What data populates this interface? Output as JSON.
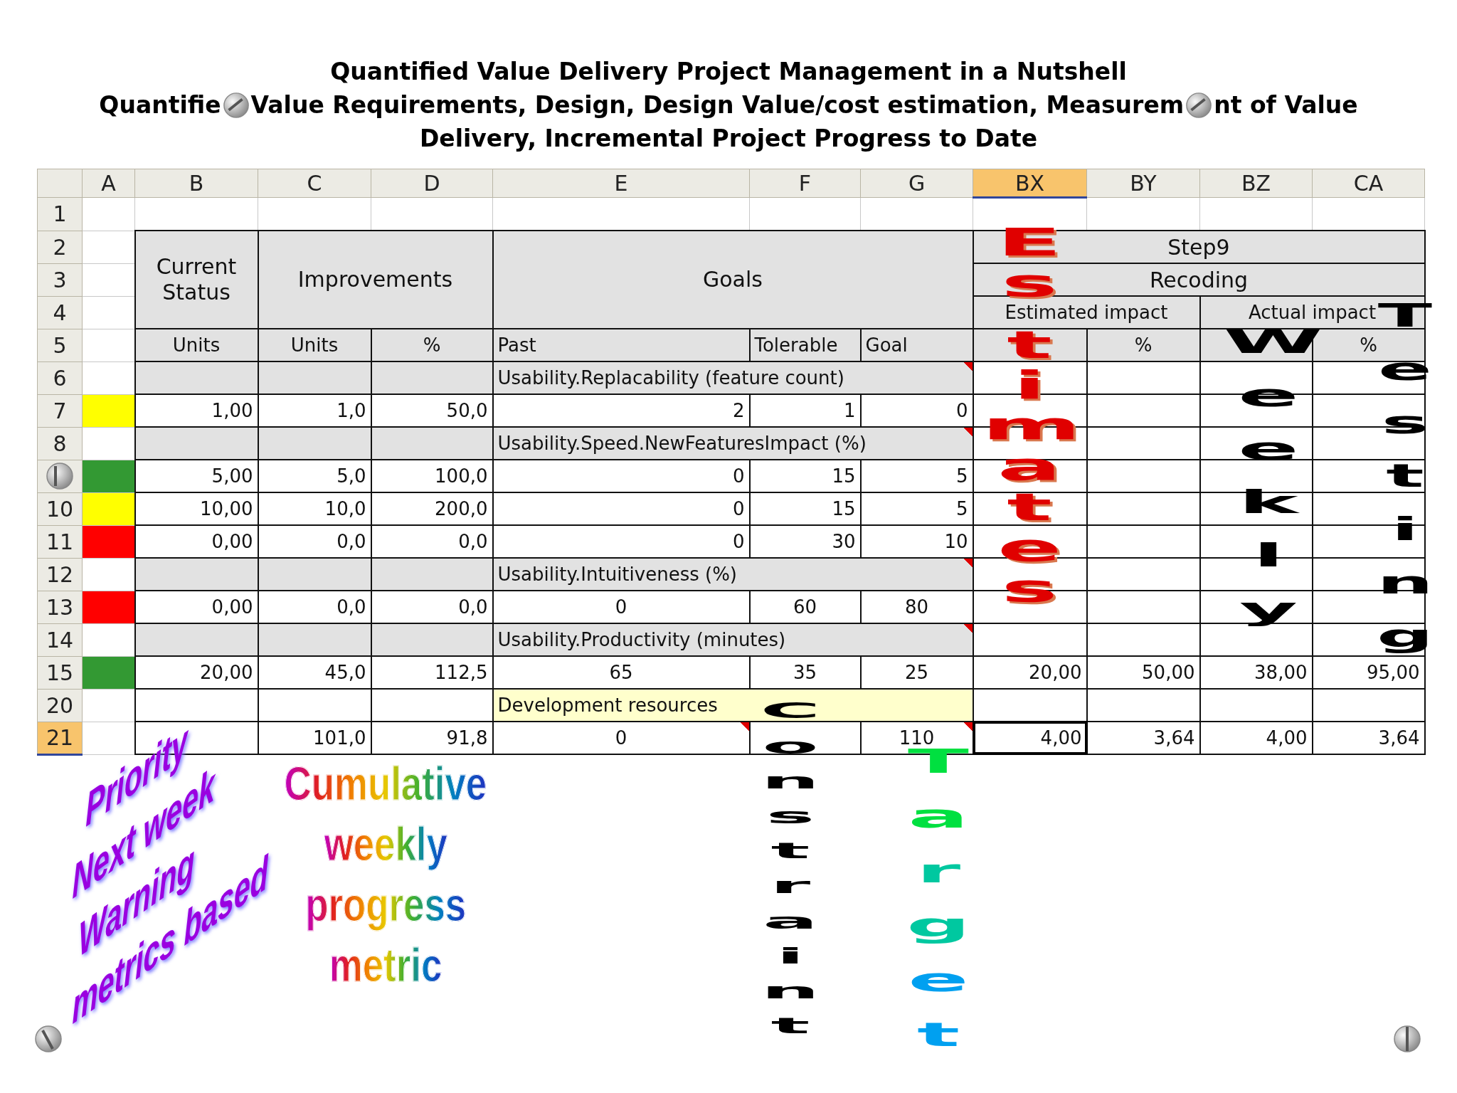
{
  "title": {
    "line_1": "Quantified Value Delivery Project Management in a Nutshell",
    "line_2_parts": [
      "Quantifie",
      "Value Requirements, Design, Design Value/cost estimation, Measurem",
      "nt of Value"
    ],
    "line_3": "Delivery, Incremental Project Progress to Date"
  },
  "columns": [
    {
      "label": "A",
      "selected": false
    },
    {
      "label": "B",
      "selected": false
    },
    {
      "label": "C",
      "selected": false
    },
    {
      "label": "D",
      "selected": false
    },
    {
      "label": "E",
      "selected": false
    },
    {
      "label": "F",
      "selected": false
    },
    {
      "label": "G",
      "selected": false
    },
    {
      "label": "BX",
      "selected": true
    },
    {
      "label": "BY",
      "selected": false
    },
    {
      "label": "BZ",
      "selected": false
    },
    {
      "label": "CA",
      "selected": false
    }
  ],
  "rows": [
    {
      "label": "1",
      "selected": false,
      "kind": "empty"
    },
    {
      "label": "2",
      "selected": false,
      "kind": "group-top",
      "cells": [
        {
          "text": "Current Status"
        },
        {
          "text": "Improvements"
        },
        {
          "text": "Goals"
        },
        {
          "text": "Step9"
        }
      ]
    },
    {
      "label": "3",
      "selected": false,
      "kind": "group-mid",
      "cells": [
        {
          "text": "Recoding"
        }
      ]
    },
    {
      "label": "4",
      "selected": false,
      "kind": "group-sub",
      "cells": [
        {
          "text": "Estimated impact"
        },
        {
          "text": "Actual impact"
        }
      ]
    },
    {
      "label": "5",
      "selected": false,
      "kind": "units",
      "cells": [
        {
          "text": "Units"
        },
        {
          "text": "Units"
        },
        {
          "text": "%"
        },
        {
          "text": "Past"
        },
        {
          "text": "Tolerable"
        },
        {
          "text": "Goal"
        },
        null,
        {
          "text": "%"
        },
        null,
        {
          "text": "%"
        }
      ]
    },
    {
      "label": "6",
      "selected": false,
      "kind": "section",
      "cells": [
        {
          "text": "Usability.Replacability (feature count)",
          "comment": true
        }
      ]
    },
    {
      "label": "7",
      "selected": false,
      "kind": "data",
      "color": "#ffff00",
      "cells": [
        {
          "text": "1,00"
        },
        {
          "text": "1,0"
        },
        {
          "text": "50,0"
        },
        {
          "text": "2"
        },
        {
          "text": "1"
        },
        {
          "text": "0"
        },
        null,
        null,
        null,
        null
      ]
    },
    {
      "label": "8",
      "selected": false,
      "kind": "section",
      "cells": [
        {
          "text": "Usability.Speed.NewFeaturesImpact (%)",
          "comment": true
        }
      ]
    },
    {
      "selected": false,
      "kind": "data",
      "color": "#339933",
      "cells": [
        {
          "text": "5,00"
        },
        {
          "text": "5,0"
        },
        {
          "text": "100,0"
        },
        {
          "text": "0"
        },
        {
          "text": "15"
        },
        {
          "text": "5"
        },
        null,
        null,
        null,
        null
      ]
    },
    {
      "label": "10",
      "selected": false,
      "kind": "data",
      "color": "#ffff00",
      "cells": [
        {
          "text": "10,00"
        },
        {
          "text": "10,0"
        },
        {
          "text": "200,0"
        },
        {
          "text": "0"
        },
        {
          "text": "15"
        },
        {
          "text": "5"
        },
        null,
        null,
        null,
        null
      ]
    },
    {
      "label": "11",
      "selected": false,
      "kind": "data",
      "color": "#ff0000",
      "cells": [
        {
          "text": "0,00"
        },
        {
          "text": "0,0"
        },
        {
          "text": "0,0"
        },
        {
          "text": "0"
        },
        {
          "text": "30"
        },
        {
          "text": "10"
        },
        null,
        null,
        null,
        null
      ]
    },
    {
      "label": "12",
      "selected": false,
      "kind": "section",
      "cells": [
        {
          "text": "Usability.Intuitiveness (%)",
          "comment": true
        }
      ]
    },
    {
      "label": "13",
      "selected": false,
      "kind": "data-centered",
      "color": "#ff0000",
      "cells": [
        {
          "text": "0,00"
        },
        {
          "text": "0,0"
        },
        {
          "text": "0,0"
        },
        {
          "text": "0"
        },
        {
          "text": "60"
        },
        {
          "text": "80"
        },
        null,
        null,
        null,
        null
      ]
    },
    {
      "label": "14",
      "selected": false,
      "kind": "section",
      "cells": [
        {
          "text": "Usability.Productivity (minutes)",
          "comment": true
        }
      ]
    },
    {
      "label": "15",
      "selected": false,
      "kind": "data-centered",
      "color": "#339933",
      "cells": [
        {
          "text": "20,00"
        },
        {
          "text": "45,0"
        },
        {
          "text": "112,5"
        },
        {
          "text": "65"
        },
        {
          "text": "35"
        },
        {
          "text": "25"
        },
        {
          "text": "20,00"
        },
        {
          "text": "50,00"
        },
        {
          "text": "38,00"
        },
        {
          "text": "95,00"
        }
      ]
    },
    {
      "label": "20",
      "selected": false,
      "kind": "resources",
      "cells": [
        {
          "text": "Development resources"
        }
      ]
    },
    {
      "label": "21",
      "selected": true,
      "kind": "data-centered",
      "cells": [
        null,
        {
          "text": "101,0"
        },
        {
          "text": "91,8"
        },
        {
          "text": "0",
          "comment": true
        },
        null,
        {
          "text": "110",
          "comment": true
        },
        {
          "text": "4,00",
          "active": true
        },
        {
          "text": "3,64"
        },
        {
          "text": "4,00"
        },
        {
          "text": "3,64"
        }
      ]
    }
  ],
  "wordart": {
    "priority_lines": [
      "Priority",
      "Next week",
      "Warning",
      "metrics based"
    ],
    "progress_lines": [
      "Cumulative",
      "weekly",
      "progress",
      "metric"
    ],
    "vertical_words": [
      {
        "kind": "estimates",
        "text": "Estimates"
      },
      {
        "kind": "weekly",
        "text": "Weekly"
      },
      {
        "kind": "testing",
        "text": "Testing"
      },
      {
        "kind": "constraint",
        "text": "Constraint"
      },
      {
        "kind": "target",
        "text": "Target"
      }
    ]
  }
}
